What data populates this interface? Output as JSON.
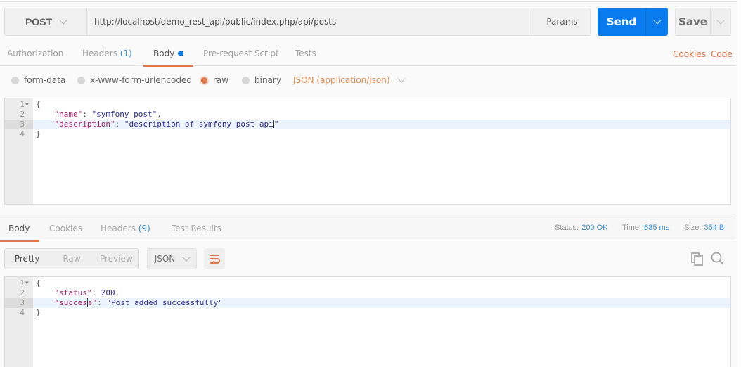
{
  "request": {
    "method": "POST",
    "url": "http://localhost/demo_rest_api/public/index.php/api/posts",
    "params_label": "Params",
    "send_label": "Send",
    "save_label": "Save"
  },
  "request_tabs": [
    {
      "label": "Authorization",
      "count": null
    },
    {
      "label": "Headers",
      "count": "(1)"
    },
    {
      "label": "Body",
      "count": null,
      "active": true,
      "modified": true
    },
    {
      "label": "Pre-request Script",
      "count": null
    },
    {
      "label": "Tests",
      "count": null
    }
  ],
  "links": {
    "cookies": "Cookies",
    "code": "Code"
  },
  "body_modes": [
    {
      "label": "form-data",
      "selected": false
    },
    {
      "label": "x-www-form-urlencoded",
      "selected": false
    },
    {
      "label": "raw",
      "selected": true
    },
    {
      "label": "binary",
      "selected": false
    }
  ],
  "content_type": "JSON (application/json)",
  "request_body": {
    "lines": [
      {
        "n": "1",
        "open": "{"
      },
      {
        "n": "2",
        "key": "\"name\"",
        "value": "\"symfony post\"",
        "trail": ","
      },
      {
        "n": "3",
        "key": "\"description\"",
        "value_before_cursor": "\"description of symfony post api",
        "value_after_cursor": "\""
      },
      {
        "n": "4",
        "close": "}"
      }
    ],
    "active_line": 3
  },
  "response_tabs": [
    {
      "label": "Body",
      "active": true
    },
    {
      "label": "Cookies"
    },
    {
      "label": "Headers",
      "count": "(9)"
    },
    {
      "label": "Test Results"
    }
  ],
  "response_meta": {
    "status_label": "Status:",
    "status": "200 OK",
    "time_label": "Time:",
    "time": "635 ms",
    "size_label": "Size:",
    "size": "354 B"
  },
  "view_modes": [
    "Pretty",
    "Raw",
    "Preview"
  ],
  "view_mode_selected": "Pretty",
  "response_format": "JSON",
  "response_body": {
    "lines": [
      {
        "n": "1",
        "open": "{"
      },
      {
        "n": "2",
        "key": "\"status\"",
        "value": "200",
        "trail": ","
      },
      {
        "n": "3",
        "key_before_cursor": "\"succes",
        "key_after_cursor": "s\"",
        "value": "\"Post added successfully\""
      },
      {
        "n": "4",
        "close": "}"
      }
    ],
    "active_line": 3
  },
  "colors": {
    "accent_orange": "#e0764a",
    "send_blue": "#097bed",
    "count_blue": "#3d8fd8"
  }
}
